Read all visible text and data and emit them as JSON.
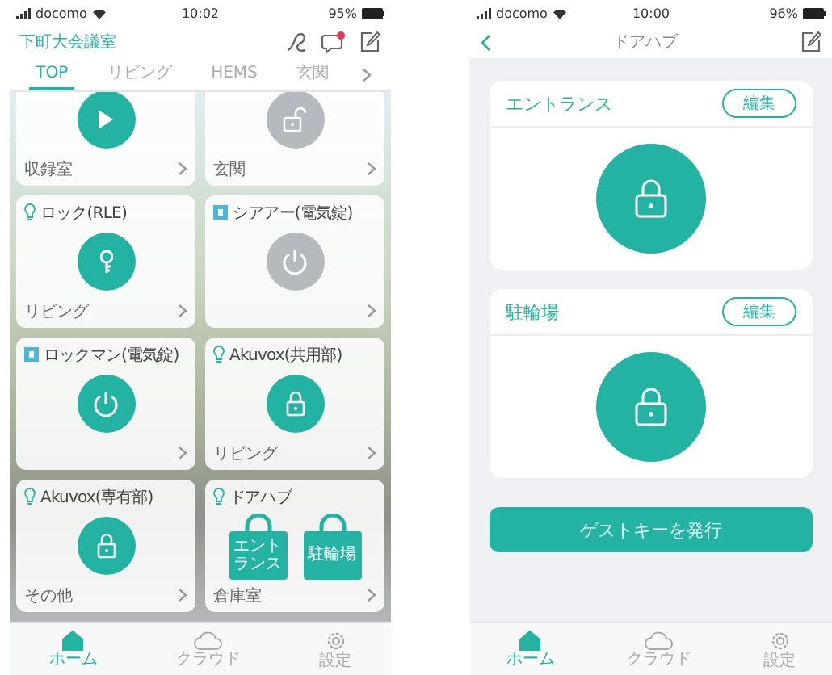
{
  "left_screen": {
    "status_bar": {
      "carrier": "docomo",
      "time": "10:02",
      "battery": "95%"
    },
    "place_name": "下町大会議室",
    "tabs": [
      {
        "label": "TOP",
        "selected": true
      },
      {
        "label": "リビング",
        "selected": false
      },
      {
        "label": "HEMS",
        "selected": false
      },
      {
        "label": "玄関",
        "selected": false
      }
    ],
    "devices": [
      {
        "kind": "play",
        "active": true,
        "room": "収録室"
      },
      {
        "kind": "unlock",
        "active": false,
        "room": "玄関"
      },
      {
        "name": "ロック(RLE)",
        "kind": "key",
        "active": true,
        "room": "リビング"
      },
      {
        "name": "シアアー(電気錠)",
        "kind": "power",
        "active": false
      },
      {
        "name": "ロックマン(電気錠)",
        "kind": "power",
        "active": true
      },
      {
        "name": "Akuvox(共用部)",
        "kind": "lock",
        "active": true,
        "room": "リビング"
      },
      {
        "name": "Akuvox(専有部)",
        "kind": "lock",
        "active": true,
        "room": "その他"
      },
      {
        "name": "ドアハブ",
        "kind": "hub",
        "room": "倉庫室",
        "locks": [
          "エントランス",
          "駐輪場"
        ]
      }
    ],
    "nav": [
      {
        "label": "ホーム",
        "kind": "home",
        "selected": true
      },
      {
        "label": "クラウド",
        "kind": "cloud",
        "selected": false
      },
      {
        "label": "設定",
        "kind": "gear",
        "selected": false
      }
    ]
  },
  "right_screen": {
    "status_bar": {
      "carrier": "docomo",
      "time": "10:00",
      "battery": "96%"
    },
    "title": "ドアハブ",
    "doors": [
      {
        "name": "エントランス",
        "edit": "編集"
      },
      {
        "name": "駐輪場",
        "edit": "編集"
      }
    ],
    "action": "ゲストキーを発行",
    "nav": [
      {
        "label": "ホーム",
        "kind": "home",
        "selected": true
      },
      {
        "label": "クラウド",
        "kind": "cloud",
        "selected": false
      },
      {
        "label": "設定",
        "kind": "gear",
        "selected": false
      }
    ]
  }
}
